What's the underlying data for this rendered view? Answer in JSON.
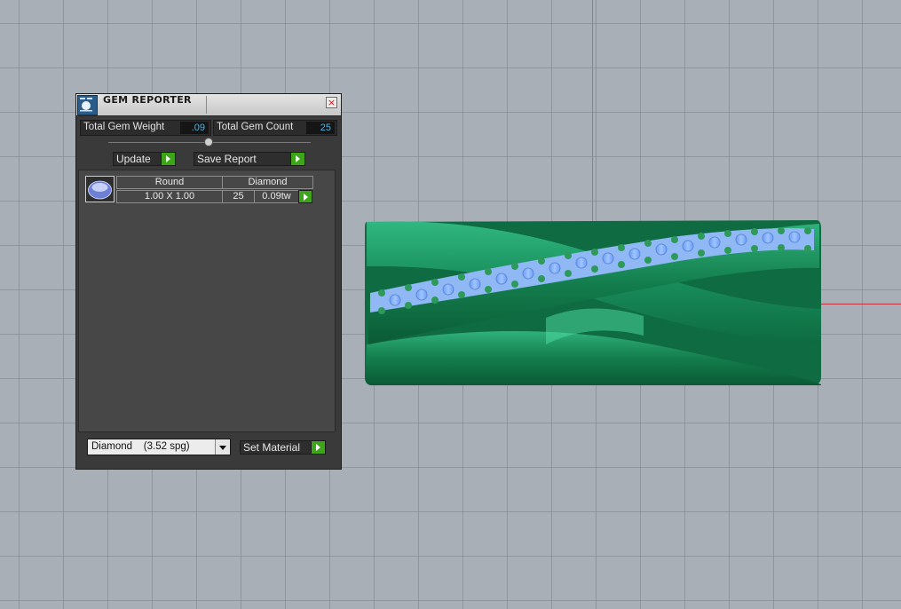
{
  "panel": {
    "title": "GEM REPORTER",
    "close_icon": "×",
    "total_weight_label": "Total Gem Weight",
    "total_weight_value": ".09",
    "total_count_label": "Total Gem Count",
    "total_count_value": "25",
    "update_label": "Update",
    "save_report_label": "Save Report",
    "table": {
      "shape_header": "Round",
      "material_header": "Diamond",
      "size": "1.00 X 1.00",
      "count": "25",
      "weight": "0.09tw"
    },
    "material_select": "Diamond    (3.52 spg)",
    "set_material_label": "Set Material"
  },
  "colors": {
    "accent_green": "#3ea51a",
    "value_blue": "#47b6e8",
    "ring_green": "#1e8a5a",
    "gem_blue": "#7fb3ff"
  }
}
